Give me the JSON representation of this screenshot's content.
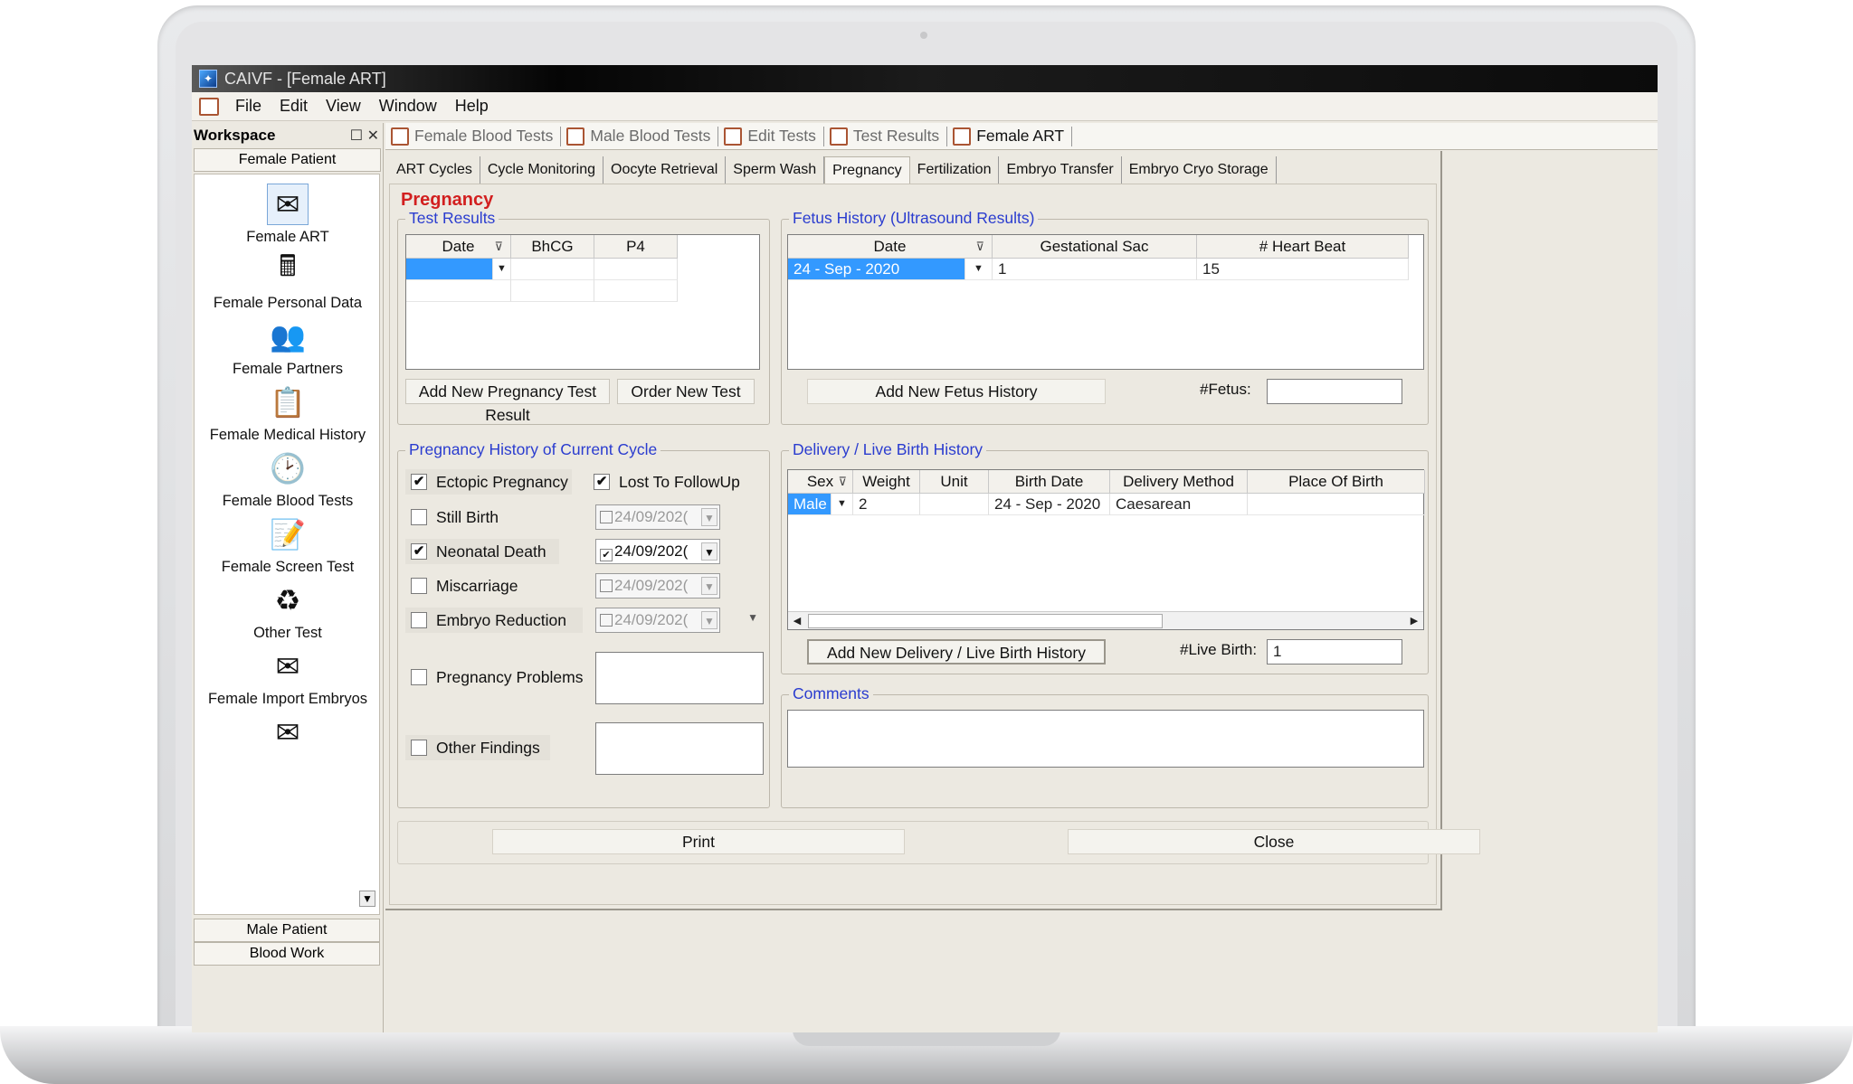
{
  "window": {
    "title": "CAIVF - [Female ART]"
  },
  "menu": [
    "File",
    "Edit",
    "View",
    "Window",
    "Help"
  ],
  "workspace": {
    "title": "Workspace",
    "controls": "☐ ✕",
    "group_top": "Female Patient",
    "items": [
      {
        "label": "Female ART",
        "icon": "✉"
      },
      {
        "label": "Female Personal Data",
        "icon": "🖩"
      },
      {
        "label": "Female Partners",
        "icon": "👥"
      },
      {
        "label": "Female Medical History",
        "icon": "📋"
      },
      {
        "label": "Female Blood Tests",
        "icon": "🕑"
      },
      {
        "label": "Female Screen Test",
        "icon": "📝"
      },
      {
        "label": "Other Test",
        "icon": "♻"
      },
      {
        "label": "Female Import Embryos",
        "icon": "✉"
      },
      {
        "label": "",
        "icon": "✉"
      }
    ],
    "group_bottom": "Male Patient",
    "group_bottom2": "Blood Work"
  },
  "doc_tabs": [
    "Female Blood Tests",
    "Male Blood Tests",
    "Edit Tests",
    "Test Results",
    "Female ART"
  ],
  "sub_tabs": [
    "ART Cycles",
    "Cycle Monitoring",
    "Oocyte Retrieval",
    "Sperm Wash",
    "Pregnancy",
    "Fertilization",
    "Embryo Transfer",
    "Embryo Cryo Storage"
  ],
  "page_title": "Pregnancy",
  "test_results": {
    "title": "Test Results",
    "columns": [
      "Date",
      "BhCG",
      "P4"
    ],
    "add_button": "Add New Pregnancy Test Result",
    "order_button": "Order New Test"
  },
  "fetus": {
    "title": "Fetus History (Ultrasound Results)",
    "columns": [
      "Date",
      "Gestational Sac",
      "# Heart Beat"
    ],
    "row": {
      "date": "24 - Sep - 2020",
      "sac": "1",
      "heartbeat": "15"
    },
    "add_button": "Add New Fetus History",
    "count_label": "#Fetus:",
    "count_value": ""
  },
  "history": {
    "title": "Pregnancy History of Current Cycle",
    "ectopic": {
      "label": "Ectopic Pregnancy",
      "checked": "✔"
    },
    "lost": {
      "label": "Lost To FollowUp",
      "checked": "✔"
    },
    "still": {
      "label": "Still Birth",
      "date": "24/09/202("
    },
    "neonatal": {
      "label": "Neonatal Death",
      "checked": "✔",
      "date": "24/09/202("
    },
    "miscarriage": {
      "label": "Miscarriage",
      "date": "24/09/202("
    },
    "reduction": {
      "label": "Embryo Reduction",
      "date": "24/09/202("
    },
    "problems": {
      "label": "Pregnancy Problems"
    },
    "findings": {
      "label": "Other Findings"
    }
  },
  "delivery": {
    "title": "Delivery / Live Birth History",
    "columns": [
      "Sex",
      "Weight",
      "Unit",
      "Birth Date",
      "Delivery Method",
      "Place Of Birth"
    ],
    "row": {
      "sex": "Male",
      "weight": "2",
      "unit": "",
      "birth_date": "24 - Sep - 2020",
      "method": "Caesarean",
      "place": ""
    },
    "add_button": "Add New Delivery / Live Birth History",
    "count_label": "#Live Birth:",
    "count_value": "1"
  },
  "comments": {
    "title": "Comments"
  },
  "footer": {
    "print": "Print",
    "close": "Close"
  },
  "colors": {
    "title_red": "#d21f1f",
    "group_blue": "#2a3ccf",
    "selection": "#3399ff"
  }
}
